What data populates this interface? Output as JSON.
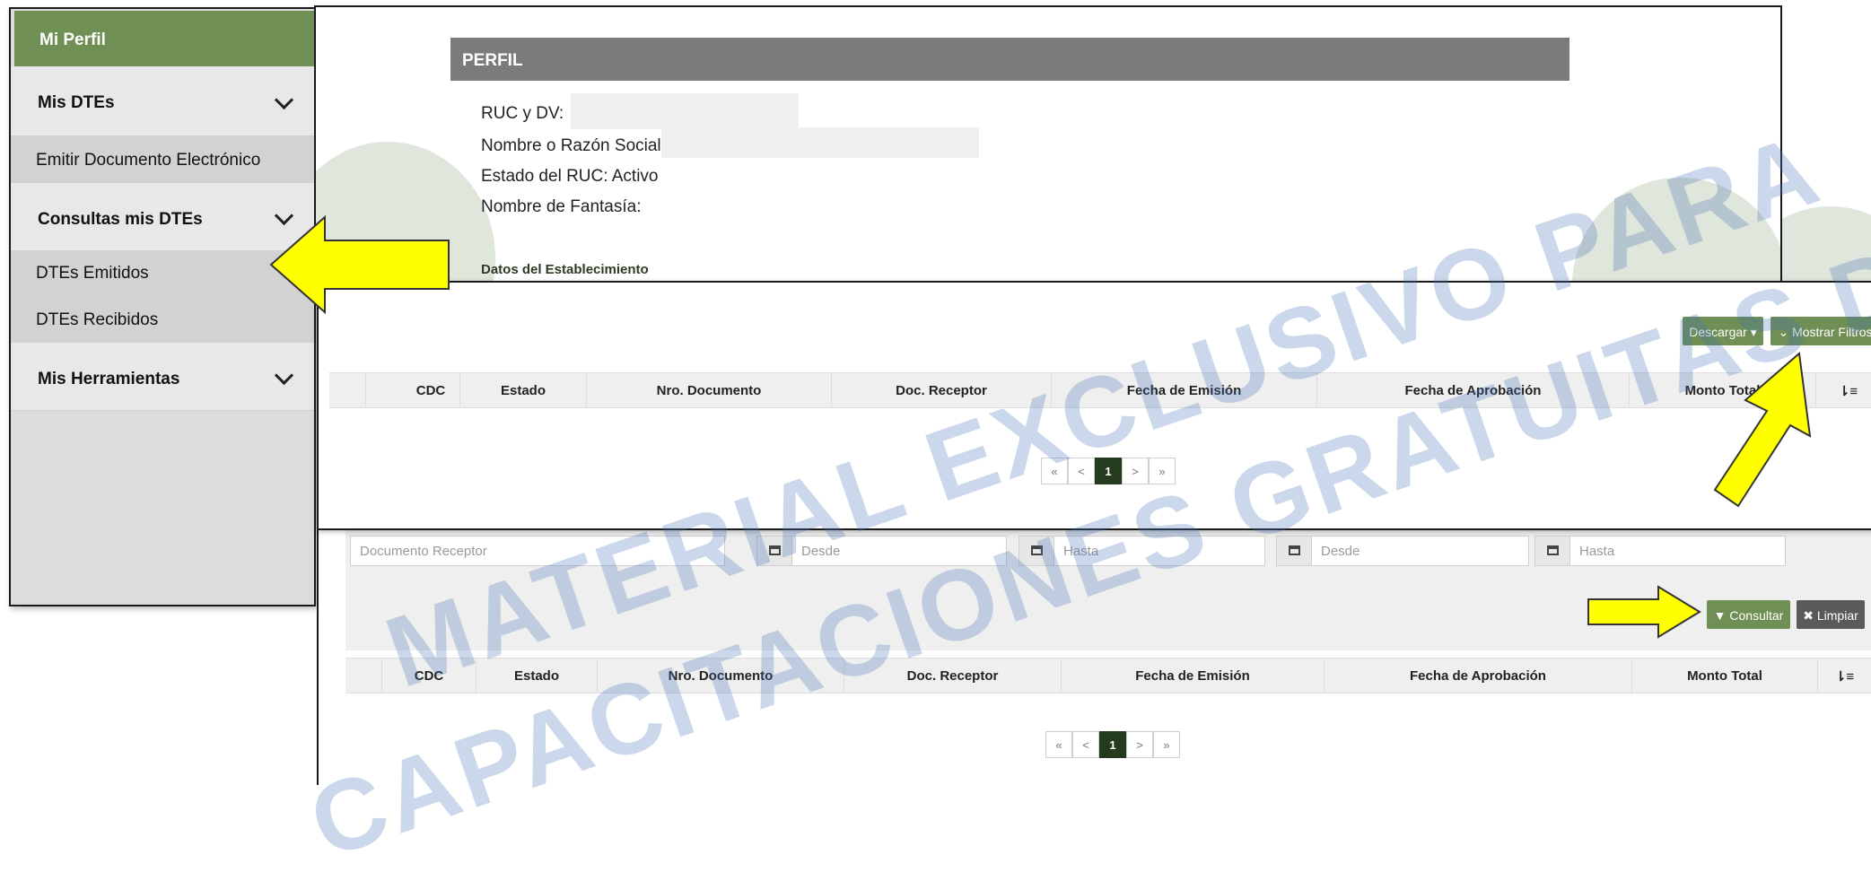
{
  "sidebar": {
    "header": "Mi Perfil",
    "items": [
      {
        "label": "Mis DTEs",
        "type": "section"
      },
      {
        "label": "Emitir Documento Electrónico",
        "type": "sub"
      },
      {
        "label": "Consultas mis DTEs",
        "type": "section"
      },
      {
        "label": "DTEs Emitidos",
        "type": "sub"
      },
      {
        "label": "DTEs Recibidos",
        "type": "sub"
      },
      {
        "label": "Mis Herramientas",
        "type": "section"
      }
    ]
  },
  "perfil": {
    "title": "PERFIL",
    "ruc_label": "RUC y DV:",
    "razon_label": "Nombre o Razón Social:",
    "estado_label": "Estado del RUC: Activo",
    "fantasia_label": "Nombre de Fantasía:",
    "establecimiento_label": "Datos del Establecimiento"
  },
  "results": {
    "descargar_label": "Descargar ▾",
    "mostrar_filtros_label": "Mostrar Filtros",
    "columns": [
      "CDC",
      "Estado",
      "Nro. Documento",
      "Doc. Receptor",
      "Fecha de Emisión",
      "Fecha de Aprobación",
      "Monto Total"
    ],
    "sort_icon": "⇂≡",
    "pagination": [
      "«",
      "<",
      "1",
      ">",
      "»"
    ]
  },
  "filters": {
    "doc_receptor_placeholder": "Documento Receptor",
    "desde_placeholder": "Desde",
    "hasta_placeholder": "Hasta",
    "consultar_label": "Consultar",
    "limpiar_label": "Limpiar",
    "columns": [
      "CDC",
      "Estado",
      "Nro. Documento",
      "Doc. Receptor",
      "Fecha de Emisión",
      "Fecha de Aprobación",
      "Monto Total"
    ],
    "pagination": [
      "«",
      "<",
      "1",
      ">",
      "»"
    ]
  },
  "watermark": {
    "line1": "MATERIAL EXCLUSIVO PARA",
    "line2": "CAPACITACIONES GRATUITAS DE LA DNIT"
  },
  "colors": {
    "brand_green": "#6f8f55",
    "pager_active": "#243b1f",
    "arrow_yellow": "#ffff00",
    "header_gray": "#7b7b7b"
  }
}
